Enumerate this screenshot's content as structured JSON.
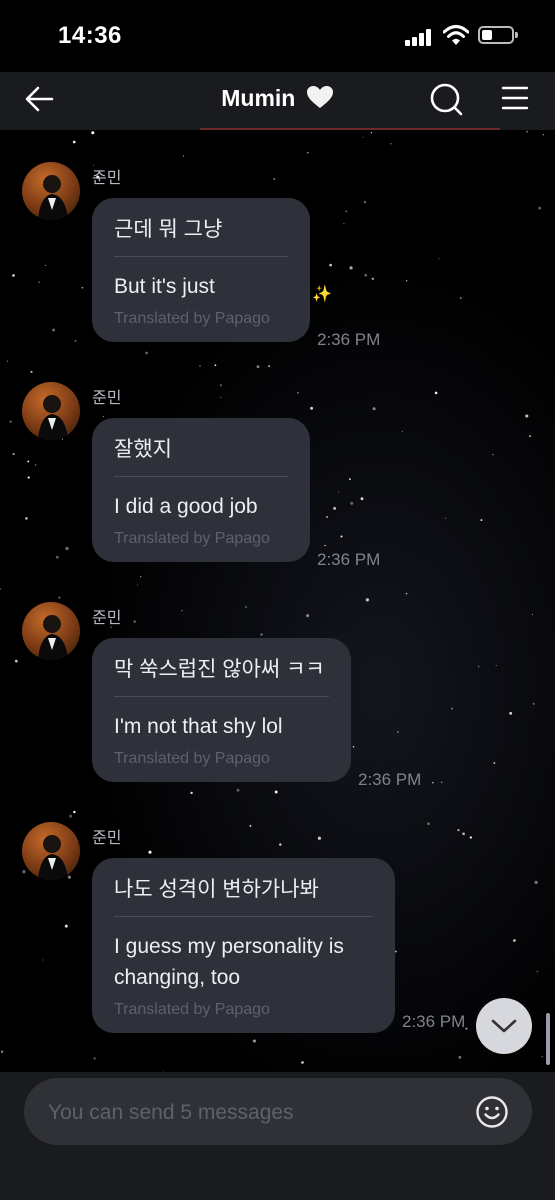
{
  "status": {
    "time": "14:36"
  },
  "header": {
    "title": "Mumin",
    "heart": "🤍"
  },
  "messages": [
    {
      "sender": "준민",
      "original": "근데 뭐 그냥",
      "translation": "But it's just",
      "translated_by": "Translated by Papago",
      "time": "2:36 PM"
    },
    {
      "sender": "준민",
      "original": "잘했지",
      "translation": "I did a good job",
      "translated_by": "Translated by Papago",
      "time": "2:36 PM"
    },
    {
      "sender": "준민",
      "original": "막 쑥스럽진 않아써 ㅋㅋ",
      "translation": "I'm not that shy lol",
      "translated_by": "Translated by Papago",
      "time": "2:36 PM"
    },
    {
      "sender": "준민",
      "original": "나도 성격이 변하가나봐",
      "translation": "I guess my personality is changing, too",
      "translated_by": "Translated by Papago",
      "time": "2:36 PM"
    }
  ],
  "composer": {
    "placeholder": "You can send 5 messages"
  },
  "icons": {
    "back": "arrow-left-icon",
    "search": "search-icon",
    "menu": "hamburger-icon",
    "emoji": "smiley-icon",
    "scroll_down": "chevron-down-icon",
    "sparkle": "sparkle-icon"
  },
  "colors": {
    "background": "#000000",
    "bubble": "#2e3139",
    "header": "#1a1b1f"
  }
}
